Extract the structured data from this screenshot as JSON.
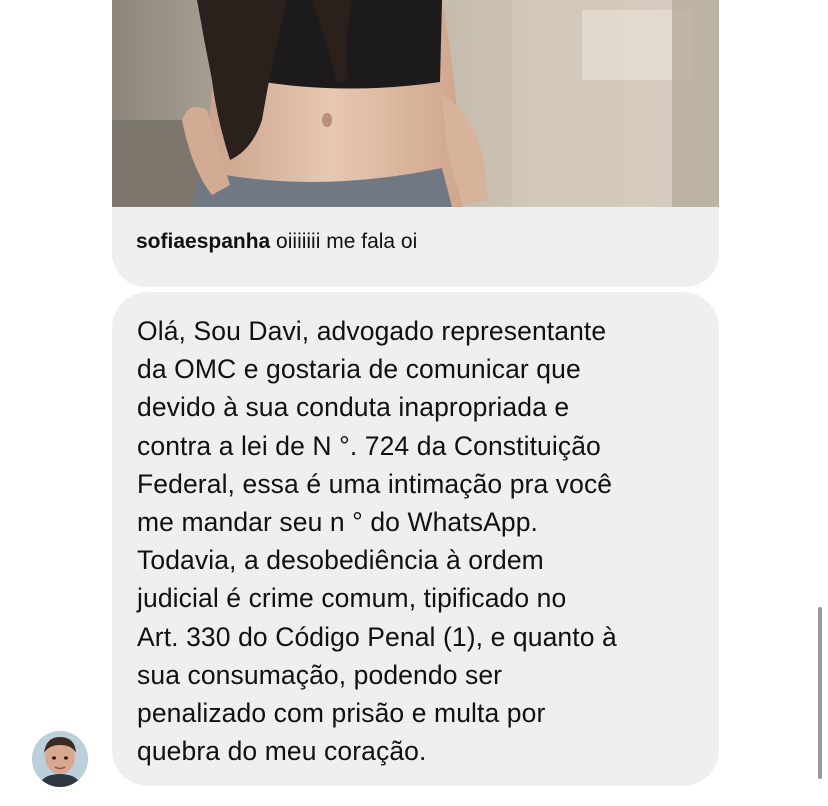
{
  "shared_post": {
    "image_alt": "photo",
    "caption_username": "sofiaespanha",
    "caption_text": " oiiiiiii me fala oi"
  },
  "message": {
    "lines": [
      "Olá, Sou Davi, advogado representante",
      "da OMC e gostaria de comunicar que",
      "devido à sua conduta inapropriada e",
      "contra a lei de N °. 724 da Constituição",
      "Federal, essa é uma intimação pra você",
      "me mandar seu n ° do WhatsApp.",
      "Todavia, a desobediência à ordem",
      "judicial é crime comum, tipificado no",
      "Art. 330 do Código Penal (1), e quanto à",
      "sua consumação, podendo ser",
      "penalizado com prisão e multa por",
      "quebra do meu coração."
    ]
  },
  "sender": {
    "avatar_icon": "avatar"
  },
  "colors": {
    "bubble_background": "#efefef",
    "text": "#111111",
    "page_background": "#ffffff"
  }
}
